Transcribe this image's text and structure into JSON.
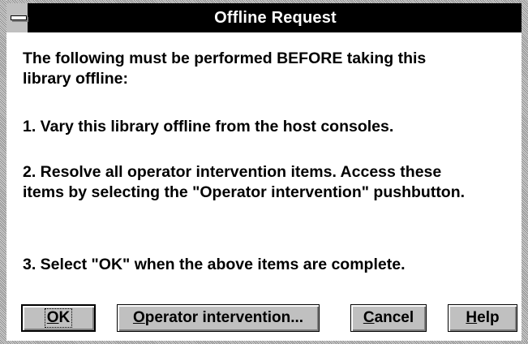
{
  "window": {
    "title": "Offline Request"
  },
  "message": {
    "line1": "The following must be performed BEFORE taking this",
    "line2": "library offline:",
    "step1": "1.  Vary this library offline from the host consoles.",
    "step2_line1": "2.  Resolve all operator intervention items. Access these",
    "step2_line2": "items by selecting the \"Operator intervention\" pushbutton.",
    "step3": "3. Select \"OK\" when the above items are complete."
  },
  "buttons": {
    "ok_mnemonic": "O",
    "ok_rest": "K",
    "operator_mnemonic": "O",
    "operator_rest": "perator intervention...",
    "cancel_mnemonic": "C",
    "cancel_rest": "ancel",
    "help_mnemonic": "H",
    "help_rest": "elp"
  }
}
